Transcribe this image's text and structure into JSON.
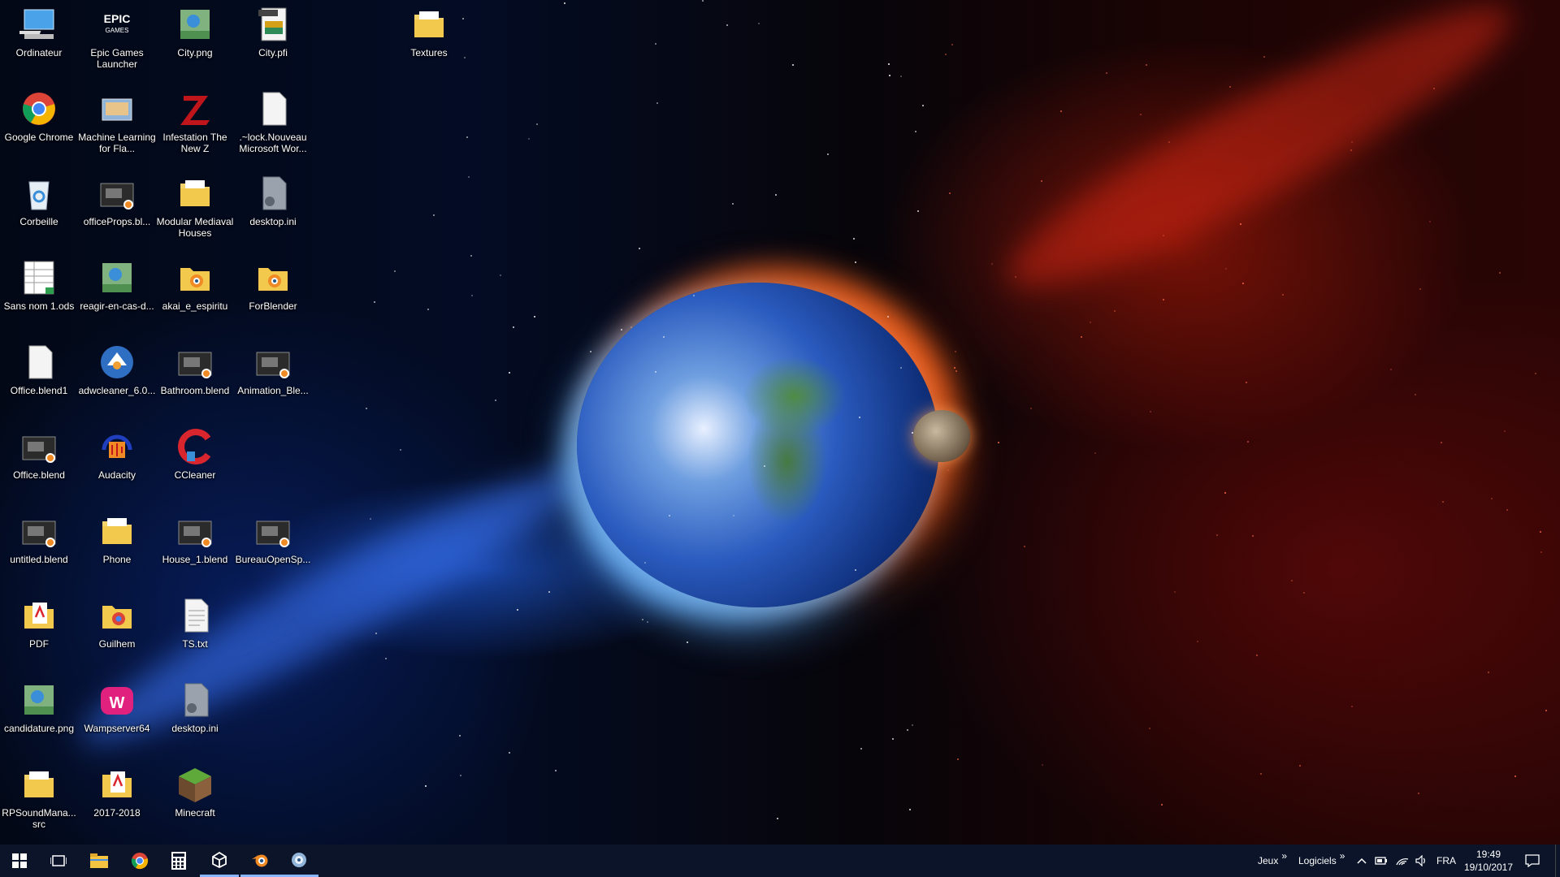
{
  "desktop_icons": [
    {
      "label": "Ordinateur",
      "icon": "computer-icon"
    },
    {
      "label": "Epic Games Launcher",
      "icon": "epic-games-icon"
    },
    {
      "label": "City.png",
      "icon": "image-file-icon"
    },
    {
      "label": "City.pfi",
      "icon": "pfi-file-icon"
    },
    {
      "label": "Textures",
      "icon": "folder-icon"
    },
    {
      "label": "Google Chrome",
      "icon": "chrome-icon"
    },
    {
      "label": "Machine Learning for Fla...",
      "icon": "application-icon"
    },
    {
      "label": "Infestation The New Z",
      "icon": "game-icon"
    },
    {
      "label": ".~lock.Nouveau Microsoft Wor...",
      "icon": "file-icon"
    },
    {
      "label": "Corbeille",
      "icon": "recycle-bin-icon"
    },
    {
      "label": "officeProps.bl...",
      "icon": "blend-file-icon"
    },
    {
      "label": "Modular Mediaval Houses",
      "icon": "folder-icon"
    },
    {
      "label": "desktop.ini",
      "icon": "settings-file-icon"
    },
    {
      "label": "Sans nom 1.ods",
      "icon": "spreadsheet-icon"
    },
    {
      "label": "reagir-en-cas-d...",
      "icon": "image-file-icon"
    },
    {
      "label": "akai_e_espiritu",
      "icon": "blender-folder-icon"
    },
    {
      "label": "ForBlender",
      "icon": "blender-folder-icon"
    },
    {
      "label": "Office.blend1",
      "icon": "file-icon"
    },
    {
      "label": "adwcleaner_6.0...",
      "icon": "adwcleaner-icon"
    },
    {
      "label": "Bathroom.blend",
      "icon": "blend-file-icon"
    },
    {
      "label": "Animation_Ble...",
      "icon": "blend-file-icon"
    },
    {
      "label": "Office.blend",
      "icon": "blend-file-icon"
    },
    {
      "label": "Audacity",
      "icon": "audacity-icon"
    },
    {
      "label": "CCleaner",
      "icon": "ccleaner-icon"
    },
    {
      "label": "untitled.blend",
      "icon": "blend-file-icon"
    },
    {
      "label": "Phone",
      "icon": "folder-icon"
    },
    {
      "label": "House_1.blend",
      "icon": "blend-file-icon"
    },
    {
      "label": "BureauOpenSp...",
      "icon": "blend-file-icon"
    },
    {
      "label": "PDF",
      "icon": "pdf-folder-icon"
    },
    {
      "label": "Guilhem",
      "icon": "chrome-folder-icon"
    },
    {
      "label": "TS.txt",
      "icon": "text-file-icon"
    },
    {
      "label": "candidature.png",
      "icon": "image-file-icon"
    },
    {
      "label": "Wampserver64",
      "icon": "wampserver-icon"
    },
    {
      "label": "desktop.ini",
      "icon": "settings-file-icon"
    },
    {
      "label": "RPSoundMana... src",
      "icon": "folder-icon"
    },
    {
      "label": "2017-2018",
      "icon": "pdf-folder-icon"
    },
    {
      "label": "Minecraft",
      "icon": "minecraft-icon"
    }
  ],
  "taskbar": {
    "pinned": [
      {
        "icon": "windows-start-icon"
      },
      {
        "icon": "task-view-icon"
      },
      {
        "icon": "file-explorer-icon"
      },
      {
        "icon": "chrome-icon"
      },
      {
        "icon": "calculator-icon"
      },
      {
        "icon": "unity-icon",
        "active": true
      },
      {
        "icon": "blender-icon",
        "active": true
      },
      {
        "icon": "unknown-app-icon",
        "active": true
      }
    ],
    "toolbar_jeux": "Jeux",
    "toolbar_logiciels": "Logiciels",
    "chevron": "»",
    "language": "FRA",
    "time": "19:49",
    "date": "19/10/2017"
  },
  "colors": {
    "taskbar": "#0b1428",
    "label_text": "#ffffff",
    "active_indicator": "#8ab4ff"
  }
}
